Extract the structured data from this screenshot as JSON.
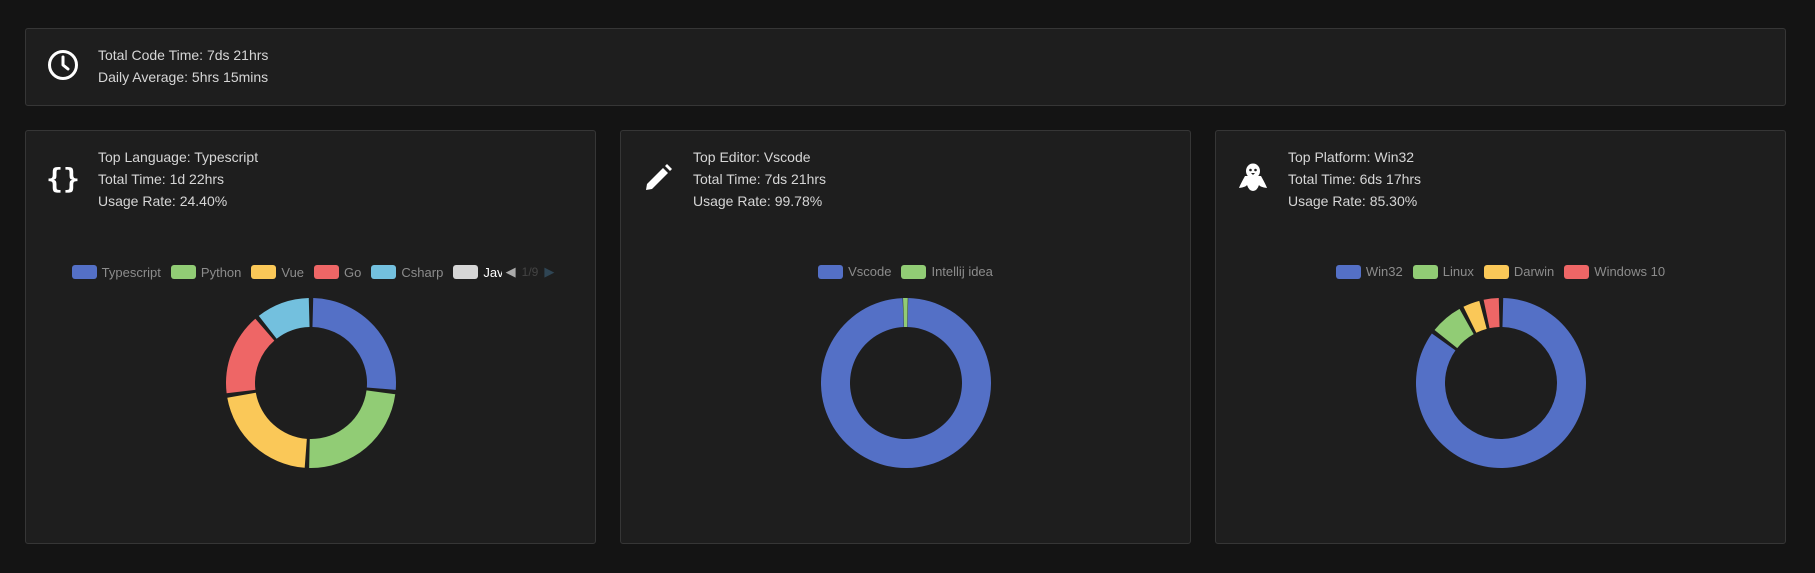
{
  "summary": {
    "icon": "clock-icon",
    "total_code_time": "Total Code Time: 7ds 21hrs",
    "daily_average": "Daily Average: 5hrs 15mins"
  },
  "language": {
    "icon": "code-braces-icon",
    "top": "Top Language: Typescript",
    "total_time": "Total Time: 1d 22hrs",
    "usage_rate": "Usage Rate: 24.40%",
    "legend_page": "1/9"
  },
  "editor": {
    "icon": "pencil-icon",
    "top": "Top Editor: Vscode",
    "total_time": "Total Time: 7ds 21hrs",
    "usage_rate": "Usage Rate: 99.78%"
  },
  "platform": {
    "icon": "linux-penguin-icon",
    "top": "Top Platform: Win32",
    "total_time": "Total Time: 6ds 17hrs",
    "usage_rate": "Usage Rate: 85.30%"
  },
  "colors": {
    "blue": "#5470c6",
    "green": "#91cc75",
    "yellow": "#fac858",
    "red": "#ee6666",
    "cyan": "#73c0de",
    "gray": "#d6d6d6"
  },
  "chart_data": [
    {
      "type": "pie",
      "legend": [
        "Typescript",
        "Python",
        "Vue",
        "Go",
        "Csharp",
        "Java"
      ],
      "series": [
        {
          "name": "Typescript",
          "value": 24.4,
          "color": "#5470c6"
        },
        {
          "name": "Python",
          "value": 22.0,
          "color": "#91cc75"
        },
        {
          "name": "Vue",
          "value": 20.0,
          "color": "#fac858"
        },
        {
          "name": "Go",
          "value": 15.0,
          "color": "#ee6666"
        },
        {
          "name": "Csharp",
          "value": 10.0,
          "color": "#73c0de"
        }
      ]
    },
    {
      "type": "pie",
      "legend": [
        "Vscode",
        "Intellij idea"
      ],
      "series": [
        {
          "name": "Vscode",
          "value": 99.78,
          "color": "#5470c6"
        },
        {
          "name": "Intellij idea",
          "value": 0.22,
          "color": "#91cc75"
        }
      ]
    },
    {
      "type": "pie",
      "legend": [
        "Win32",
        "Linux",
        "Darwin",
        "Windows 10"
      ],
      "series": [
        {
          "name": "Win32",
          "value": 85.3,
          "color": "#5470c6"
        },
        {
          "name": "Linux",
          "value": 7.0,
          "color": "#91cc75"
        },
        {
          "name": "Darwin",
          "value": 4.0,
          "color": "#fac858"
        },
        {
          "name": "Windows 10",
          "value": 3.7,
          "color": "#ee6666"
        }
      ]
    }
  ]
}
